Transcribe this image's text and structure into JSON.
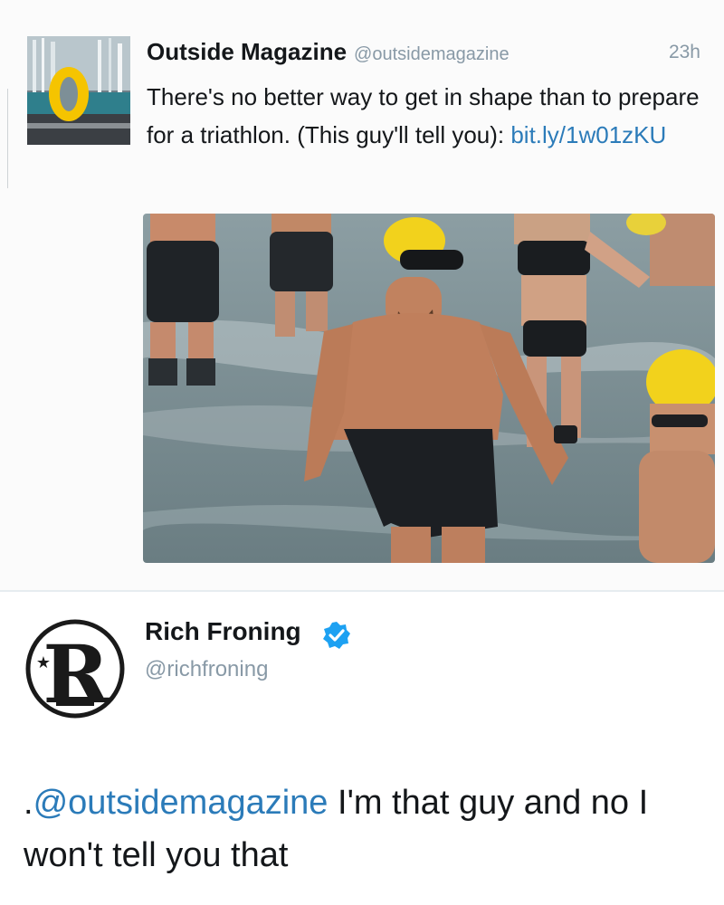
{
  "tweet1": {
    "author_name": "Outside Magazine",
    "handle": "@outsidemagazine",
    "time": "23h",
    "text_before_link": "There's no better way to get in shape than to prepare for a triathlon. (This guy'll tell you): ",
    "link": "bit.ly/1w01zKU",
    "avatar_icon": "outside-logo-icon",
    "media_icon": "triathlon-swimmers-photo"
  },
  "tweet2": {
    "author_name": "Rich Froning",
    "handle": "@richfroning",
    "verified_icon": "verified-badge-icon",
    "avatar_icon": "rich-froning-logo-icon",
    "text_prefix": ".",
    "mention": "@outsidemagazine",
    "text_after_mention": " I'm that guy and no I won't tell you that"
  },
  "colors": {
    "link": "#2b7bb9",
    "muted": "#8899a6",
    "text": "#14171a",
    "verified": "#1da1f2",
    "outside_yellow": "#f5c400"
  }
}
